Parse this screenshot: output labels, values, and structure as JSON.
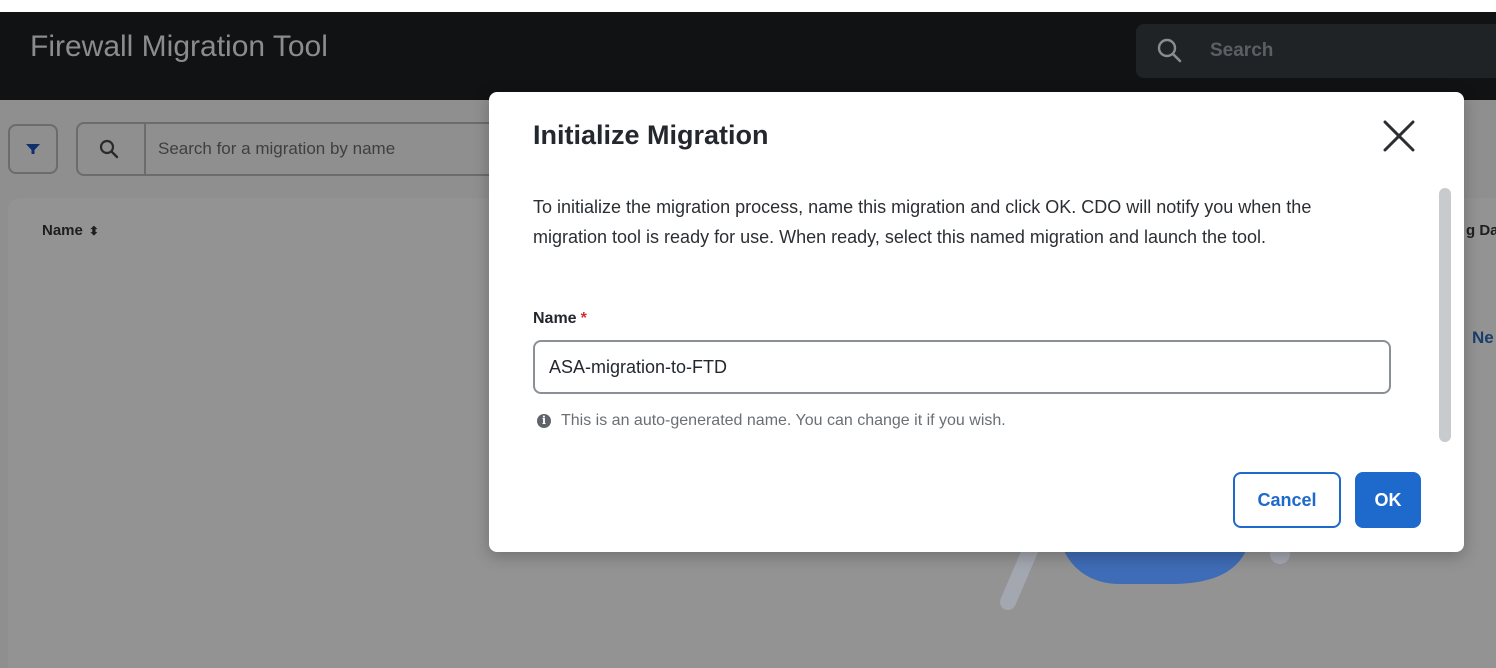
{
  "header": {
    "title": "Firewall Migration Tool",
    "search_placeholder": "Search"
  },
  "migrations_list": {
    "search_placeholder": "Search for a migration by name",
    "columns": {
      "name": "Name",
      "date_partial": "g Da"
    },
    "new_link_partial": "Ne"
  },
  "modal": {
    "title": "Initialize Migration",
    "description": "To initialize the migration process, name this migration and click OK. CDO will notify you when the migration tool is ready for use. When ready, select this named migration and launch the tool.",
    "name_label": "Name",
    "required_marker": "*",
    "name_value": "ASA-migration-to-FTD",
    "hint": "This is an auto-generated name. You can change it if you wish.",
    "cancel_label": "Cancel",
    "ok_label": "OK"
  },
  "colors": {
    "topbar": "#101214",
    "primary": "#1d69cc",
    "overlay": "#8f8f8f",
    "required": "#d32f2f"
  },
  "icons": {
    "search": "search-icon",
    "filter": "filter-icon",
    "close": "close-icon",
    "sort": "sort-icon",
    "info": "info-icon"
  }
}
